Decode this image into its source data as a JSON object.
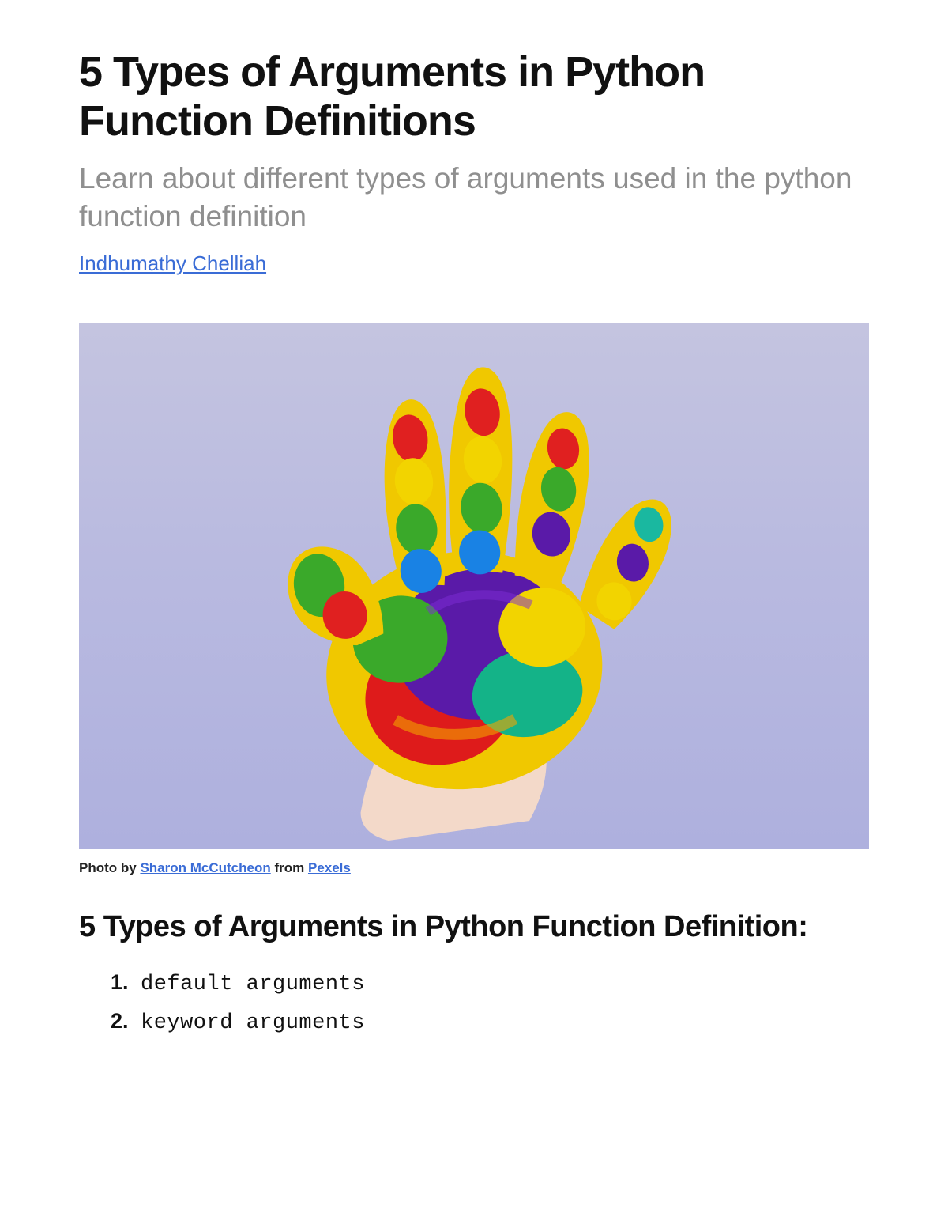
{
  "title": "5 Types of Arguments in Python Function Definitions",
  "subtitle": "Learn about different types of arguments used in the python function definition",
  "author": "Indhumathy Chelliah",
  "caption": {
    "prefix": "Photo by ",
    "credit_name": "Sharon McCutcheon",
    "mid": " from ",
    "source_name": "Pexels"
  },
  "section_heading": "5 Types of Arguments in Python Function Definition:",
  "argument_types": [
    "default arguments",
    "keyword arguments"
  ]
}
